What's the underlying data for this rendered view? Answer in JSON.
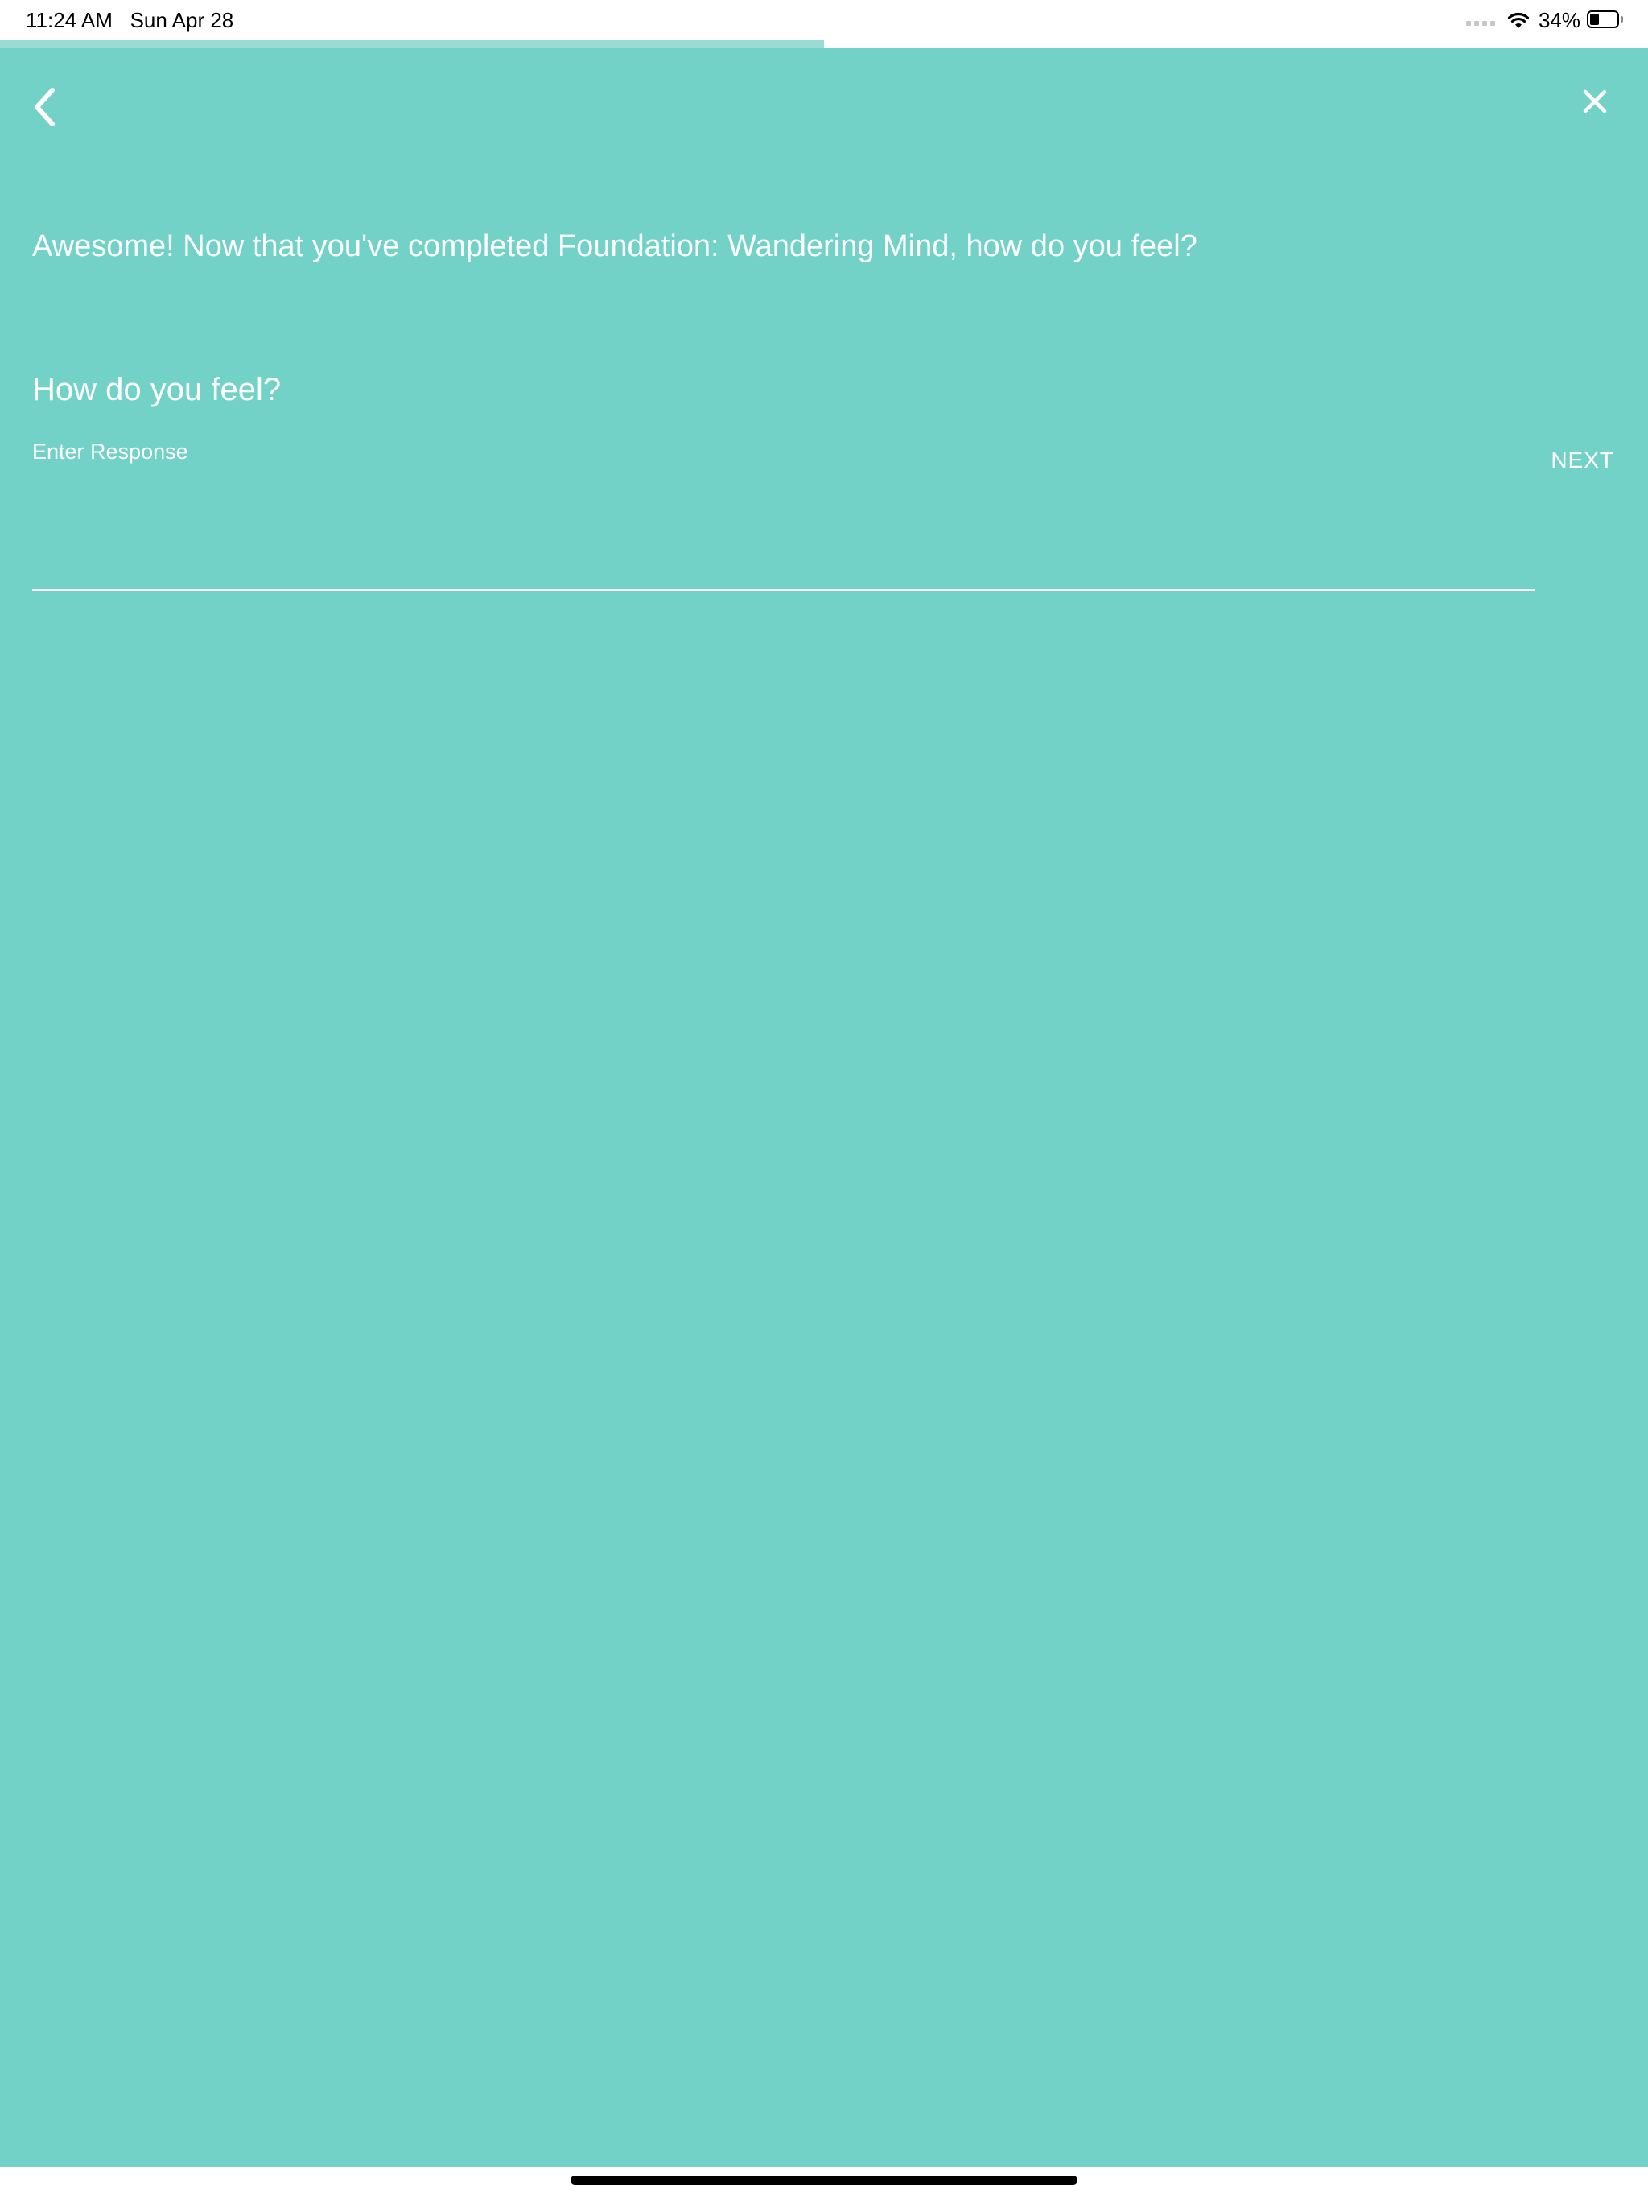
{
  "status_bar": {
    "time_date": "11:24 AM   Sun Apr 28",
    "battery_percent": "34%",
    "battery_level": 0.34,
    "icons": [
      "signal-dots-icon",
      "wifi-icon",
      "battery-icon"
    ]
  },
  "progress": {
    "value": 0.5
  },
  "nav": {
    "back_icon": "chevron-left-icon",
    "close_icon": "close-icon"
  },
  "prompt": {
    "text": "Awesome! Now that you've completed Foundation: Wandering Mind, how do you feel?"
  },
  "question": {
    "title": "How do you feel?",
    "field_label": "Enter Response",
    "value": "",
    "next_label": "NEXT"
  },
  "colors": {
    "background": "#72d2c7",
    "progress_fill": "#9adcd4",
    "text": "#ffffff"
  }
}
